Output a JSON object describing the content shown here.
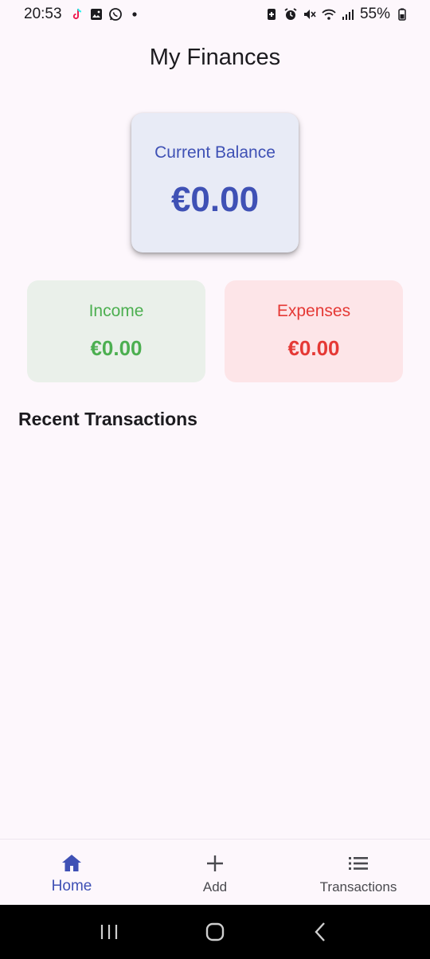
{
  "status_bar": {
    "time": "20:53",
    "battery": "55%",
    "left_icons": [
      "tiktok-icon",
      "gallery-icon",
      "whatsapp-icon",
      "dot-icon"
    ],
    "right_icons": [
      "battery-saver-icon",
      "alarm-icon",
      "mute-icon",
      "wifi-icon",
      "signal-icon",
      "battery-icon"
    ]
  },
  "app": {
    "title": "My Finances"
  },
  "balance": {
    "label": "Current Balance",
    "amount": "€0.00"
  },
  "income": {
    "label": "Income",
    "amount": "€0.00"
  },
  "expenses": {
    "label": "Expenses",
    "amount": "€0.00"
  },
  "recent": {
    "title": "Recent Transactions"
  },
  "bottom_nav": {
    "items": [
      {
        "label": "Home",
        "icon": "home-icon",
        "active": true
      },
      {
        "label": "Add",
        "icon": "plus-icon",
        "active": false
      },
      {
        "label": "Transactions",
        "icon": "list-icon",
        "active": false
      }
    ]
  },
  "colors": {
    "accent": "#3f51b5",
    "income": "#4caf50",
    "expense": "#e53935",
    "background": "#fdf7fc"
  }
}
